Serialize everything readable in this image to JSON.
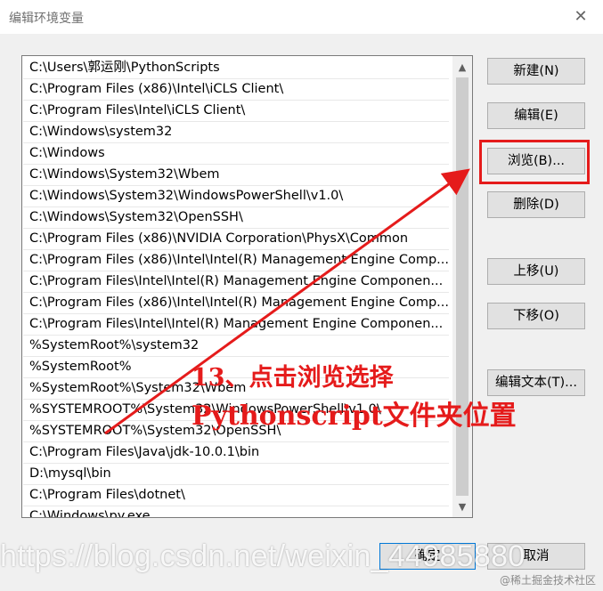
{
  "window": {
    "title": "编辑环境变量",
    "close_glyph": "✕"
  },
  "path_list": {
    "entries": [
      "C:\\Users\\郭运刚\\PythonScripts",
      "C:\\Program Files (x86)\\Intel\\iCLS Client\\",
      "C:\\Program Files\\Intel\\iCLS Client\\",
      "C:\\Windows\\system32",
      "C:\\Windows",
      "C:\\Windows\\System32\\Wbem",
      "C:\\Windows\\System32\\WindowsPowerShell\\v1.0\\",
      "C:\\Windows\\System32\\OpenSSH\\",
      "C:\\Program Files (x86)\\NVIDIA Corporation\\PhysX\\Common",
      "C:\\Program Files (x86)\\Intel\\Intel(R) Management Engine Comp...",
      "C:\\Program Files\\Intel\\Intel(R) Management Engine Componen...",
      "C:\\Program Files (x86)\\Intel\\Intel(R) Management Engine Comp...",
      "C:\\Program Files\\Intel\\Intel(R) Management Engine Componen...",
      "%SystemRoot%\\system32",
      "%SystemRoot%",
      "%SystemRoot%\\System32\\Wbem",
      "%SYSTEMROOT%\\System32\\WindowsPowerShell\\v1.0\\",
      "%SYSTEMROOT%\\System32\\OpenSSH\\",
      "C:\\Program Files\\Java\\jdk-10.0.1\\bin",
      "D:\\mysql\\bin",
      "C:\\Program Files\\dotnet\\",
      "C:\\Windows\\py.exe"
    ],
    "scroll_up": "▲",
    "scroll_down": "▼"
  },
  "buttons": {
    "new": "新建(N)",
    "edit": "编辑(E)",
    "browse": "浏览(B)...",
    "delete": "删除(D)",
    "move_up": "上移(U)",
    "move_down": "下移(O)",
    "edit_text": "编辑文本(T)...",
    "ok": "确定",
    "cancel": "取消"
  },
  "annotation": {
    "line1": "13、点击浏览选择",
    "line2": "Pythonscript文件夹位置",
    "color": "#e51b1b"
  },
  "watermark": {
    "url": "https://blog.csdn.net/weixin_44985880",
    "juejin": "@稀土掘金技术社区"
  }
}
